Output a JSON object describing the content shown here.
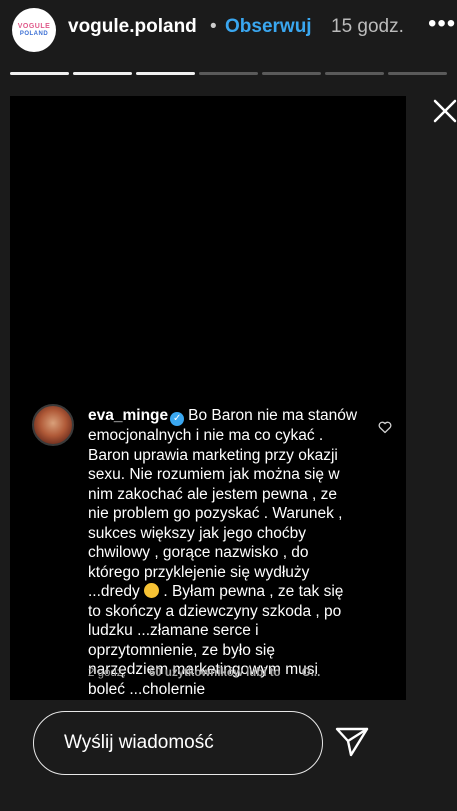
{
  "header": {
    "avatar_line1": "VOGULE",
    "avatar_line2": "POLAND",
    "username": "vogule.poland",
    "separator": "•",
    "follow_label": "Obserwuj",
    "time": "15 godz.",
    "more_icon": "more-horizontal-icon"
  },
  "progress": {
    "total_segments": 7,
    "completed_segments": 3
  },
  "comment": {
    "username": "eva_minge",
    "verified_icon": "verified-badge-icon",
    "text_part1": "Bo Baron nie ma stanów emocjonalnych i nie ma co cykać . Baron uprawia marketing przy okazji sexu. Nie rozumiem jak można się w nim zakochać ale jestem pewna , ze nie problem go pozyskać . Warunek , sukces większy jak jego choćby chwilowy , gorące nazwisko , do którego przyklejenie się wydłuży ...dredy",
    "emoji": "🤗",
    "text_part2": ". Byłam pewna , ze tak się to skończy a dziewczyny szkoda , po ludzku ...złamane serce i oprzytomnienie, ze było się narzędziem marketingowym musi boleć ...cholernie",
    "time": "2 godz.",
    "likes": "60 użytkowników lubi to",
    "reply": "O..."
  },
  "footer": {
    "message_placeholder": "Wyślij wiadomość",
    "send_icon": "paper-plane-icon"
  },
  "colors": {
    "accent": "#3aa7f0",
    "background": "#1b1b1b",
    "story_bg": "#000000"
  }
}
